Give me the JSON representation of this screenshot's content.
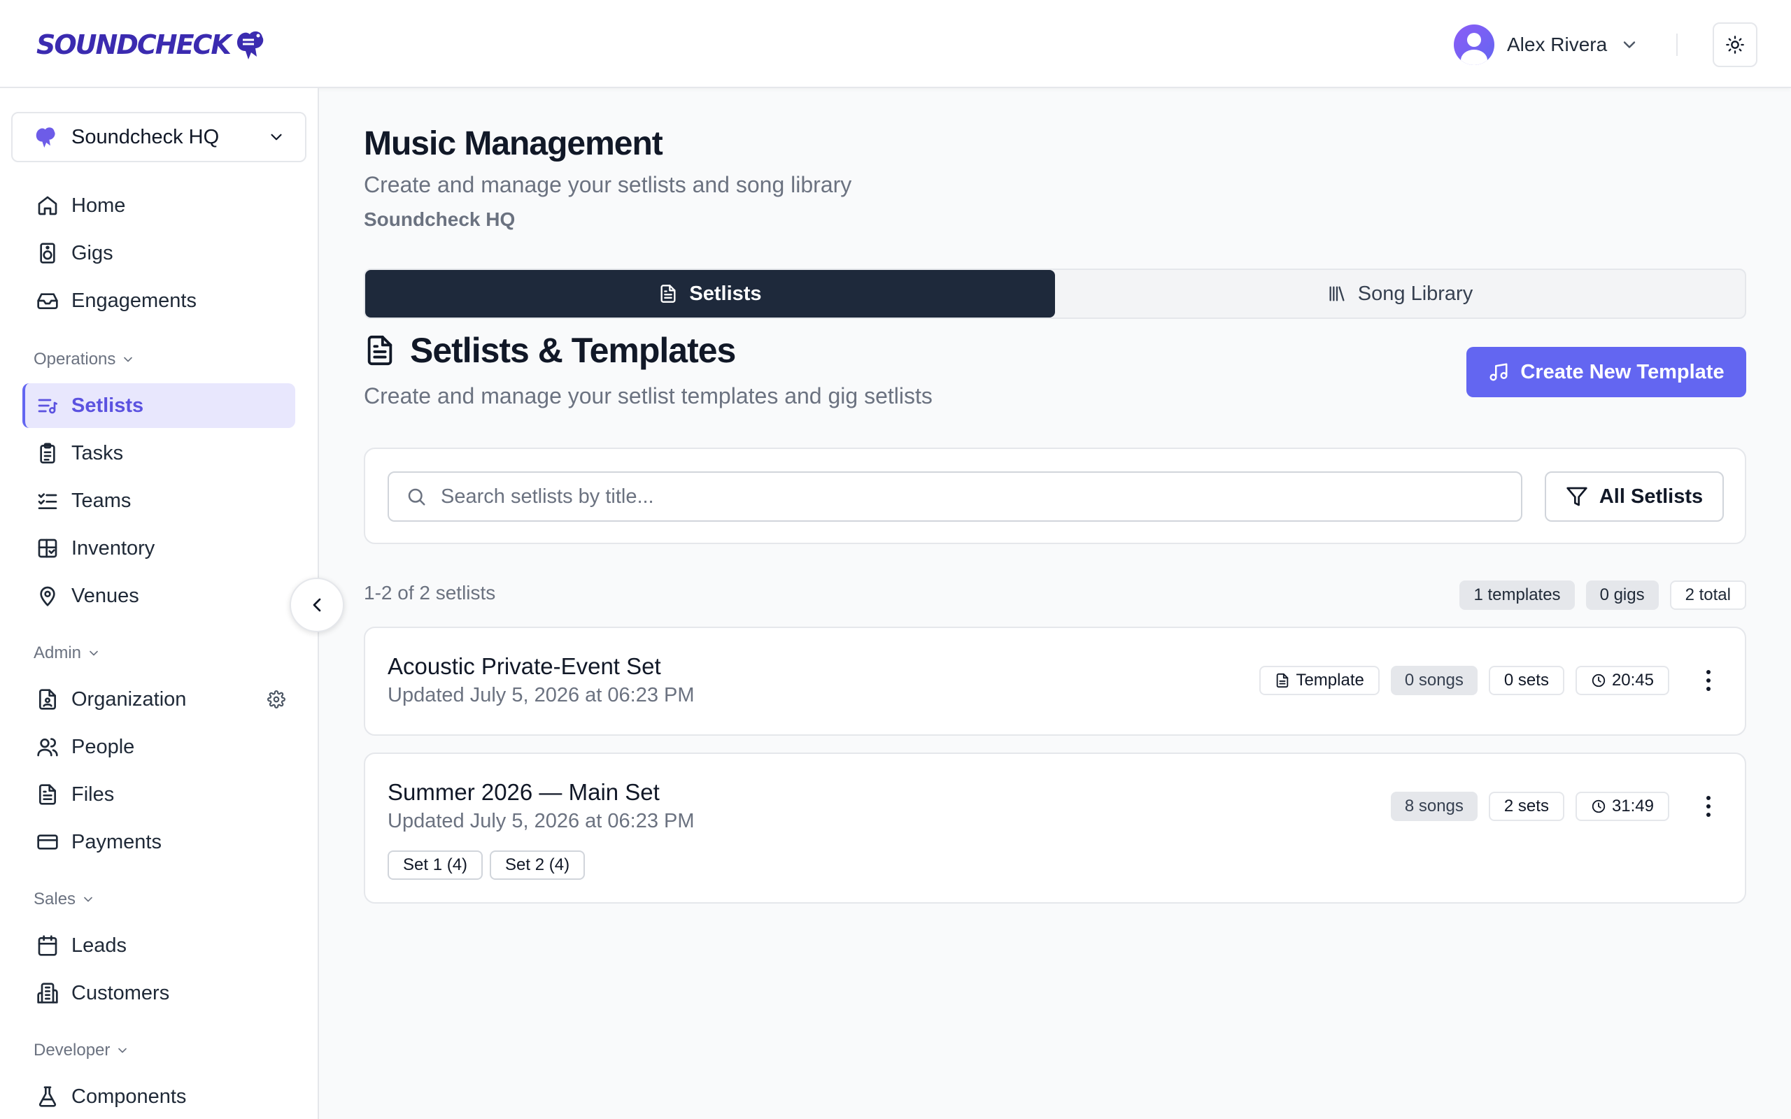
{
  "header": {
    "logo_text": "SOUNDCHECK",
    "user_name": "Alex Rivera"
  },
  "sidebar": {
    "org_name": "Soundcheck HQ",
    "items_main": [
      {
        "label": "Home",
        "icon": "home-icon"
      },
      {
        "label": "Gigs",
        "icon": "speaker-icon"
      },
      {
        "label": "Engagements",
        "icon": "inbox-icon"
      }
    ],
    "sections": {
      "operations": "Operations",
      "admin": "Admin",
      "sales": "Sales",
      "developer": "Developer"
    },
    "items_operations": [
      {
        "label": "Setlists",
        "icon": "list-music-icon",
        "active": true
      },
      {
        "label": "Tasks",
        "icon": "clipboard-icon"
      },
      {
        "label": "Teams",
        "icon": "list-checks-icon"
      },
      {
        "label": "Inventory",
        "icon": "layout-grid-icon"
      },
      {
        "label": "Venues",
        "icon": "map-pin-icon"
      }
    ],
    "items_admin": [
      {
        "label": "Organization",
        "icon": "file-user-icon"
      },
      {
        "label": "People",
        "icon": "users-icon"
      },
      {
        "label": "Files",
        "icon": "file-icon"
      },
      {
        "label": "Payments",
        "icon": "credit-card-icon"
      }
    ],
    "items_sales": [
      {
        "label": "Leads",
        "icon": "calendar-icon"
      },
      {
        "label": "Customers",
        "icon": "building-icon"
      }
    ],
    "items_developer": [
      {
        "label": "Components",
        "icon": "flask-icon"
      }
    ]
  },
  "main": {
    "title": "Music Management",
    "subtitle": "Create and manage your setlists and song library",
    "org": "Soundcheck HQ",
    "tabs": [
      {
        "label": "Setlists",
        "active": true
      },
      {
        "label": "Song Library",
        "active": false
      }
    ],
    "section_title": "Setlists & Templates",
    "section_subtitle": "Create and manage your setlist templates and gig setlists",
    "create_button": "Create New Template",
    "search_placeholder": "Search setlists by title...",
    "filter_button": "All Setlists",
    "count_text": "1-2 of 2 setlists",
    "stats": {
      "templates": "1 templates",
      "gigs": "0 gigs",
      "total": "2 total"
    },
    "setlists": [
      {
        "title": "Acoustic Private-Event Set",
        "updated": "Updated July 5, 2026 at 06:23 PM",
        "template_label": "Template",
        "songs": "0 songs",
        "sets": "0 sets",
        "duration": "20:45"
      },
      {
        "title": "Summer 2026 — Main Set",
        "updated": "Updated July 5, 2026 at 06:23 PM",
        "songs": "8 songs",
        "sets": "2 sets",
        "duration": "31:49",
        "set_chips": [
          "Set 1 (4)",
          "Set 2 (4)"
        ]
      }
    ]
  },
  "colors": {
    "accent": "#6366f1",
    "active_bg": "#e8e7fd",
    "tab_active": "#1e293b",
    "logo": "#3b2bb0"
  }
}
